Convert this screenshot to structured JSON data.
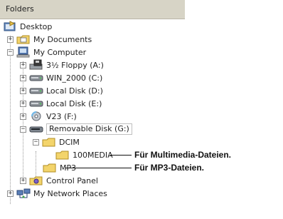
{
  "header": {
    "title": "Folders"
  },
  "tree": {
    "desktop": "Desktop",
    "my_documents": "My Documents",
    "my_computer": "My Computer",
    "floppy": "3½ Floppy (A:)",
    "c_drive": "WIN_2000 (C:)",
    "d_drive": "Local Disk (D:)",
    "e_drive": "Local Disk (E:)",
    "f_drive": "V23 (F:)",
    "g_drive": "Removable Disk (G:)",
    "dcim": "DCIM",
    "media": "100MEDIA",
    "mp3": "MP3",
    "control_panel": "Control Panel",
    "network": "My Network Places"
  },
  "expanders": {
    "my_documents": "+",
    "my_computer": "−",
    "floppy": "+",
    "c_drive": "+",
    "d_drive": "+",
    "e_drive": "+",
    "f_drive": "+",
    "g_drive": "−",
    "dcim": "−",
    "control_panel": "+",
    "network": "+"
  },
  "annotations": {
    "media": "Für Multimedia-Dateien.",
    "mp3": "Für MP3-Dateien."
  },
  "icons": {
    "desktop": "desktop-icon",
    "my_documents": "documents-folder-icon",
    "my_computer": "computer-icon",
    "floppy": "floppy-drive-icon",
    "c_drive": "hard-disk-icon",
    "d_drive": "hard-disk-icon",
    "e_drive": "hard-disk-icon",
    "f_drive": "cd-drive-icon",
    "g_drive": "removable-disk-icon",
    "dcim": "folder-icon",
    "media": "folder-icon",
    "mp3": "folder-icon",
    "control_panel": "control-panel-icon",
    "network": "network-places-icon"
  },
  "colors": {
    "header_bg": "#d7d4c6",
    "folder": "#f3d46b",
    "drive": "#8a8f96",
    "selected_border": "#bfbfbf"
  }
}
